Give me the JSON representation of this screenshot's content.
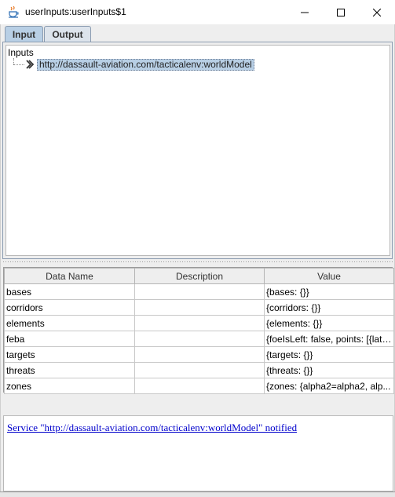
{
  "window": {
    "title": "userInputs:userInputs$1",
    "icon": "java-cup-icon"
  },
  "tabs": [
    {
      "label": "Input",
      "selected": true
    },
    {
      "label": "Output",
      "selected": false
    }
  ],
  "tree": {
    "root_label": "Inputs",
    "nodes": [
      {
        "label": "http://dassault-aviation.com/tacticalenv:worldModel",
        "selected": true
      }
    ]
  },
  "table": {
    "headers": [
      "Data Name",
      "Description",
      "Value"
    ],
    "rows": [
      {
        "name": "bases",
        "description": "",
        "value": "{bases: {}}"
      },
      {
        "name": "corridors",
        "description": "",
        "value": "{corridors: {}}"
      },
      {
        "name": "elements",
        "description": "",
        "value": "{elements: {}}"
      },
      {
        "name": "feba",
        "description": "",
        "value": "{foeIsLeft: false, points: [{lati..."
      },
      {
        "name": "targets",
        "description": "",
        "value": "{targets: {}}"
      },
      {
        "name": "threats",
        "description": "",
        "value": "{threats: {}}"
      },
      {
        "name": "zones",
        "description": "",
        "value": "{zones: {alpha2=alpha2, alp..."
      }
    ]
  },
  "status": {
    "message": "Service \"http://dassault-aviation.com/tacticalenv:worldModel\" notified"
  }
}
